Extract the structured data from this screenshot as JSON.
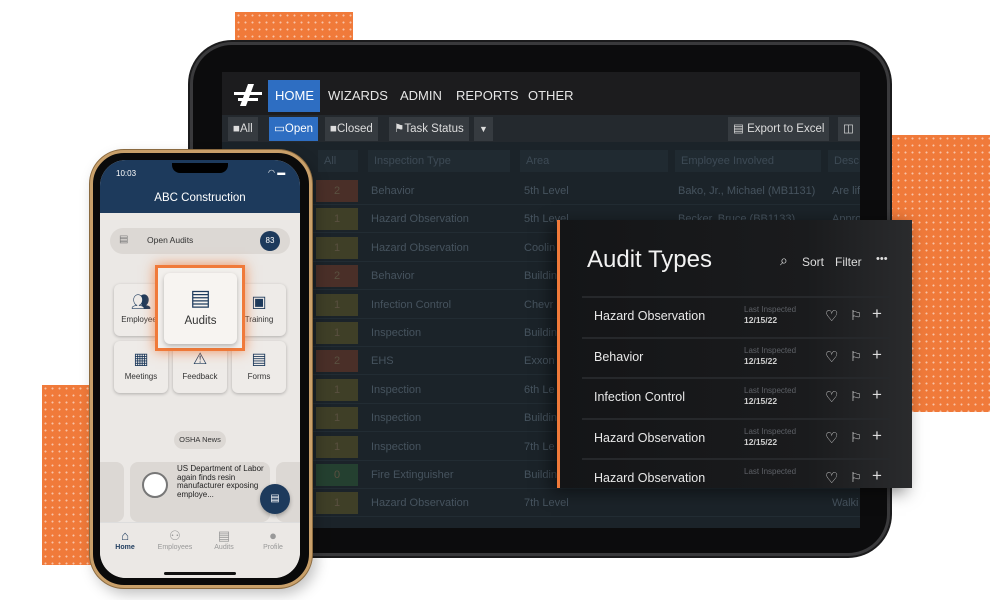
{
  "colors": {
    "accent": "#f07a3a",
    "brand_blue": "#2e6ec2",
    "phone_navy": "#1d3a5c",
    "count_2": "#4a2f28",
    "count_1": "#3f3f27",
    "count_0": "#244030"
  },
  "tablet": {
    "nav": [
      "HOME",
      "WIZARDS",
      "ADMIN",
      "REPORTS",
      "OTHER"
    ],
    "toolbar": {
      "all": "All",
      "open": "Open",
      "closed": "Closed",
      "task_status": "Task Status",
      "export": "Export to Excel"
    },
    "filters": {
      "count": "All",
      "inspection_type": "Inspection Type",
      "area": "Area",
      "employee": "Employee Involved",
      "desc": "Desc"
    },
    "rows": [
      {
        "count": "2",
        "level": 2,
        "type": "Behavior",
        "area": "5th Level",
        "employee": "Bako, Jr., Michael (MB1131)",
        "desc": "Are lif"
      },
      {
        "count": "1",
        "level": 1,
        "type": "Hazard Observation",
        "area": "5th Level",
        "employee": "Becker, Bruce (BB1133)",
        "desc": "Appro"
      },
      {
        "count": "1",
        "level": 1,
        "type": "Hazard Observation",
        "area": "Coolin",
        "employee": "",
        "desc": ""
      },
      {
        "count": "2",
        "level": 2,
        "type": "Behavior",
        "area": "Buildin",
        "employee": "",
        "desc": ""
      },
      {
        "count": "1",
        "level": 1,
        "type": "Infection Control",
        "area": "Chevr",
        "employee": "",
        "desc": ""
      },
      {
        "count": "1",
        "level": 1,
        "type": "Inspection",
        "area": "Buildin",
        "employee": "",
        "desc": ""
      },
      {
        "count": "2",
        "level": 2,
        "type": "EHS",
        "area": "Exxon",
        "employee": "",
        "desc": ""
      },
      {
        "count": "1",
        "level": 1,
        "type": "Inspection",
        "area": "6th Le",
        "employee": "",
        "desc": ""
      },
      {
        "count": "1",
        "level": 1,
        "type": "Inspection",
        "area": "Buildin",
        "employee": "",
        "desc": ""
      },
      {
        "count": "1",
        "level": 1,
        "type": "Inspection",
        "area": "7th Le",
        "employee": "",
        "desc": ""
      },
      {
        "count": "0",
        "level": 0,
        "type": "Fire Extinguisher",
        "area": "Buildin",
        "employee": "",
        "desc": ""
      },
      {
        "count": "1",
        "level": 1,
        "type": "Hazard Observation",
        "area": "7th Level",
        "employee": "",
        "desc": "Walki"
      }
    ]
  },
  "panel": {
    "title": "Audit Types",
    "sort": "Sort",
    "filter": "Filter",
    "more": "•••",
    "items": [
      {
        "name": "Hazard Observation",
        "label": "Last Inspected",
        "date": "12/15/22"
      },
      {
        "name": "Behavior",
        "label": "Last Inspected",
        "date": "12/15/22"
      },
      {
        "name": "Infection Control",
        "label": "Last Inspected",
        "date": "12/15/22"
      },
      {
        "name": "Hazard Observation",
        "label": "Last Inspected",
        "date": "12/15/22"
      },
      {
        "name": "Hazard Observation",
        "label": "Last Inspected",
        "date": ""
      }
    ]
  },
  "phone": {
    "time": "10:03",
    "title": "ABC Construction",
    "open_audits": "Open Audits",
    "open_count": "83",
    "tiles": {
      "employees": "Employees",
      "audits": "Audits",
      "training": "Training",
      "meetings": "Meetings",
      "feedback": "Feedback",
      "forms": "Forms"
    },
    "news_label": "OSHA News",
    "news_text": "US Department of Labor again finds resin manufacturer exposing employe...",
    "bottom_nav": [
      "Home",
      "Employees",
      "Audits",
      "Profile"
    ]
  }
}
